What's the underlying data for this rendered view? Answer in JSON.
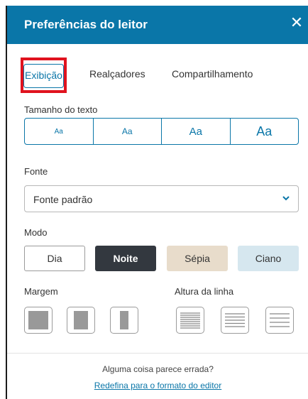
{
  "header": {
    "title": "Preferências do leitor",
    "close_icon": "close-icon"
  },
  "tabs": [
    {
      "label": "Exibição",
      "active": true
    },
    {
      "label": "Realçadores",
      "active": false
    },
    {
      "label": "Compartilhamento",
      "active": false
    }
  ],
  "text_size": {
    "label": "Tamanho do texto",
    "options": [
      "Aa",
      "Aa",
      "Aa",
      "Aa"
    ]
  },
  "font": {
    "label": "Fonte",
    "value": "Fonte padrão"
  },
  "mode": {
    "label": "Modo",
    "options": [
      {
        "label": "Dia",
        "bg": "#ffffff",
        "fg": "#333333"
      },
      {
        "label": "Noite",
        "bg": "#33383f",
        "fg": "#ffffff"
      },
      {
        "label": "Sépia",
        "bg": "#e8dccb",
        "fg": "#333333"
      },
      {
        "label": "Ciano",
        "bg": "#d6e7ef",
        "fg": "#333333"
      }
    ],
    "selected": "Noite"
  },
  "margin": {
    "label": "Margem"
  },
  "line_height": {
    "label": "Altura da linha"
  },
  "footer": {
    "question": "Alguma coisa parece errada?",
    "reset_link": "Redefina para o formato do editor"
  },
  "colors": {
    "accent": "#0a76a8",
    "highlight": "#e0121e"
  }
}
